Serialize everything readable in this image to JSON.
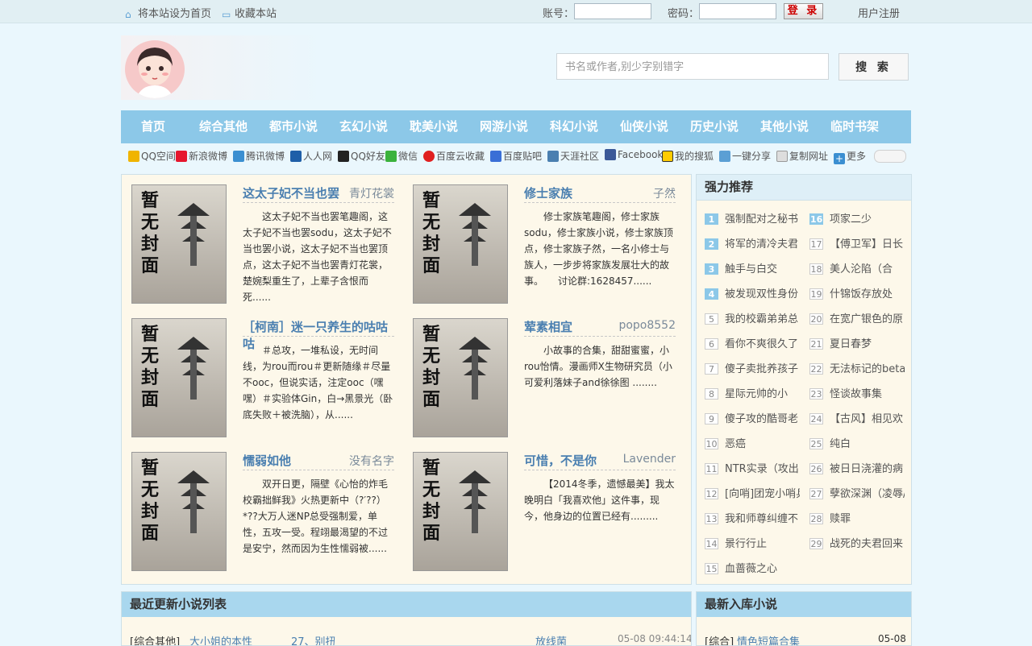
{
  "topbar": {
    "home_link": "将本站设为首页",
    "fav_link": "收藏本站",
    "account_label": "账号：",
    "password_label": "密码：",
    "login_button": "登 录",
    "register_link": "用户注册"
  },
  "search": {
    "placeholder": "书名或作者,别少字别错字",
    "button": "搜 索"
  },
  "nav": [
    "首页",
    "综合其他",
    "都市小说",
    "玄幻小说",
    "耽美小说",
    "网游小说",
    "科幻小说",
    "仙侠小说",
    "历史小说",
    "其他小说",
    "临时书架"
  ],
  "share": [
    {
      "label": "QQ空间",
      "color": "#f0b400"
    },
    {
      "label": "新浪微博",
      "color": "#e6162d"
    },
    {
      "label": "腾讯微博",
      "color": "#3b8fd1"
    },
    {
      "label": "人人网",
      "color": "#1f5fa8"
    },
    {
      "label": "QQ好友",
      "color": "#222222"
    },
    {
      "label": "微信",
      "color": "#3bb23c"
    },
    {
      "label": "百度云收藏",
      "color": "#e02020"
    },
    {
      "label": "百度贴吧",
      "color": "#3a6fd6"
    },
    {
      "label": "天涯社区",
      "color": "#4a7fb0"
    },
    {
      "label": "Facebook",
      "color": "#3b5998"
    },
    {
      "label": "我的搜狐",
      "color": "#ffcc00"
    },
    {
      "label": "一键分享",
      "color": "#5b9fd4"
    },
    {
      "label": "复制网址",
      "color": "#999999"
    },
    {
      "label": "更多",
      "color": "#3b8fd1"
    }
  ],
  "cover_text": "暂无封面",
  "books": [
    {
      "title": "这太子妃不当也罢",
      "author": "青灯花裳",
      "desc": "这太子妃不当也罢笔趣阁，这太子妃不当也罢sodu，这太子妃不当也罢小说，这太子妃不当也罢顶点，这太子妃不当也罢青灯花裳，楚婉梨重生了，上辈子含恨而死......"
    },
    {
      "title": "修士家族",
      "author": "子然",
      "desc": "修士家族笔趣阁，修士家族sodu，修士家族小说，修士家族顶点，修士家族子然，一名小修士与族人，一步步将家族发展壮大的故事。　　讨论群:1628457......"
    },
    {
      "title": "［柯南］迷一只养生的咕咕咕",
      "author": "",
      "desc": "＃总攻，一堆私设，无时间线，为rou而rou＃更新随缘＃尽量不ooc，但说实话，注定ooc（嘿嘿）＃实验体Gin，白→黑景光（卧底失败＋被洗脑），从......"
    },
    {
      "title": "荤素相宜",
      "author": "popo8552",
      "desc": "小故事的合集，甜甜蜜蜜，小rou怡情。漫画师X生物研究员（小可爱利落妹子and徐徐图 ........"
    },
    {
      "title": "懦弱如他",
      "author": "没有名字",
      "desc": "双开日更，隔壁《心怡的炸毛校霸拙鲜我》火热更新中（?′??）*??大万人迷NP总受强制爱，单性，五攻一受。程翊最渴望的不过是安宁，然而因为生性懦弱被......"
    },
    {
      "title": "可惜，不是你",
      "author": "Lavender",
      "desc": "【2014冬季，遗憾最美】我太晚明白「我喜欢他」这件事，现今，他身边的位置已经有........."
    }
  ],
  "recommend": {
    "title": "强力推荐",
    "items": [
      {
        "n": "1",
        "t": "强制配对之秘书"
      },
      {
        "n": "2",
        "t": "将军的清冷夫君"
      },
      {
        "n": "3",
        "t": "触手与白交"
      },
      {
        "n": "4",
        "t": "被发现双性身份"
      },
      {
        "n": "5",
        "t": "我的校霸弟弟总"
      },
      {
        "n": "6",
        "t": "看你不爽很久了"
      },
      {
        "n": "7",
        "t": "傻子卖批养孩子"
      },
      {
        "n": "8",
        "t": "星际元帅的小"
      },
      {
        "n": "9",
        "t": "傻子攻的酷哥老"
      },
      {
        "n": "10",
        "t": "恶癌"
      },
      {
        "n": "11",
        "t": "NTR实录（攻出"
      },
      {
        "n": "12",
        "t": "[向哨]团宠小哨兵"
      },
      {
        "n": "13",
        "t": "我和师尊纠缠不"
      },
      {
        "n": "14",
        "t": "景行行止"
      },
      {
        "n": "15",
        "t": "血蔷薇之心"
      },
      {
        "n": "16",
        "t": "项家二少"
      },
      {
        "n": "17",
        "t": "【傅卫军】日长"
      },
      {
        "n": "18",
        "t": "美人沦陷（合"
      },
      {
        "n": "19",
        "t": "什锦饭存放处"
      },
      {
        "n": "20",
        "t": "在宽广银色的原"
      },
      {
        "n": "21",
        "t": "夏日春梦"
      },
      {
        "n": "22",
        "t": "无法标记的beta"
      },
      {
        "n": "23",
        "t": "怪谈故事集"
      },
      {
        "n": "24",
        "t": "【古风】相见欢"
      },
      {
        "n": "25",
        "t": "纯白"
      },
      {
        "n": "26",
        "t": "被日日浇灌的病"
      },
      {
        "n": "27",
        "t": "孽欲深渊（凌辱/"
      },
      {
        "n": "28",
        "t": "赎罪"
      },
      {
        "n": "29",
        "t": "战死的夫君回来"
      }
    ]
  },
  "latest": {
    "title": "最近更新小说列表",
    "row": {
      "category": "[综合其他]",
      "title": "大小姐的本性",
      "chapter": "27、别扭",
      "author": "放线菌",
      "time": "05-08 09:44:14"
    }
  },
  "newest": {
    "title": "最新入库小说",
    "row": {
      "category": "[综合]",
      "title": "情色短篇合集",
      "date": "05-08"
    }
  }
}
